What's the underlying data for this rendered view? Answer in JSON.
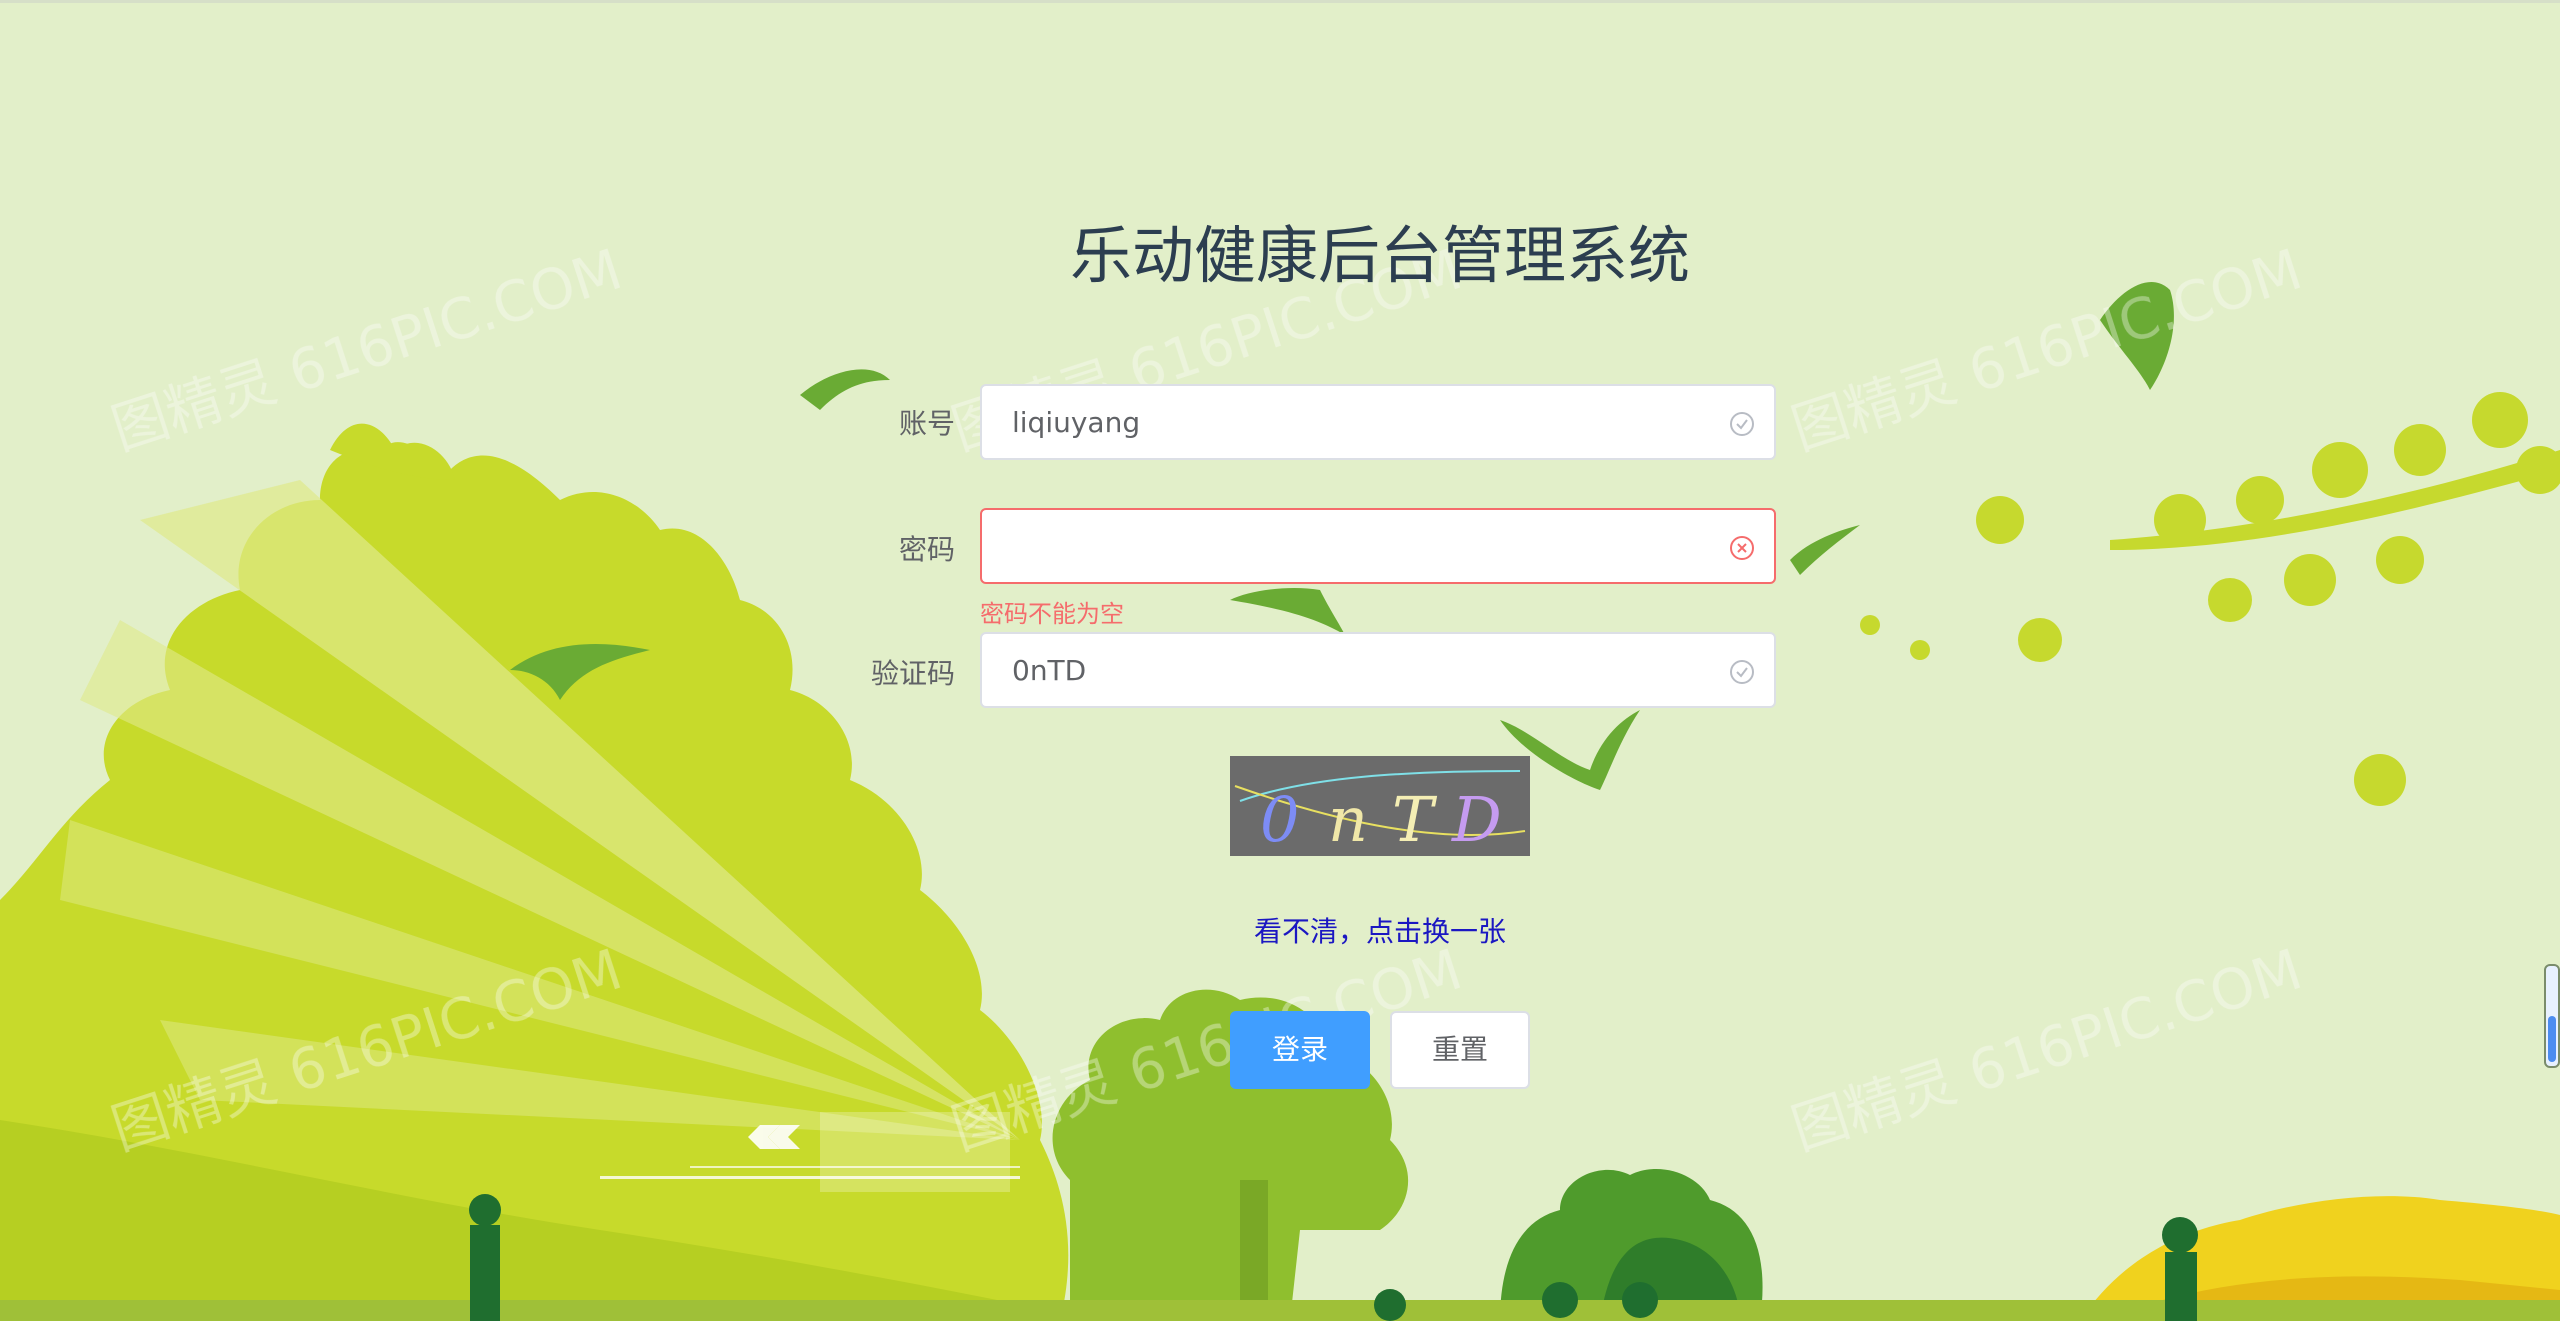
{
  "title": "乐动健康后台管理系统",
  "form": {
    "account_label": "账号",
    "account_value": "liqiuyang",
    "password_label": "密码",
    "password_value": "",
    "password_error": "密码不能为空",
    "captcha_label": "验证码",
    "captcha_value": "0nTD"
  },
  "captcha": {
    "text": "0nTD",
    "refresh_link": "看不清，点击换一张"
  },
  "buttons": {
    "login": "登录",
    "reset": "重置"
  },
  "watermark": "图精灵 616PIC.COM",
  "colors": {
    "primary": "#409eff",
    "error": "#f56c6c",
    "link": "#1b17c2",
    "title": "#2c3e50"
  },
  "icons": {
    "account_status": "check-circle-icon",
    "password_status": "close-circle-icon",
    "captcha_status": "check-circle-icon"
  }
}
